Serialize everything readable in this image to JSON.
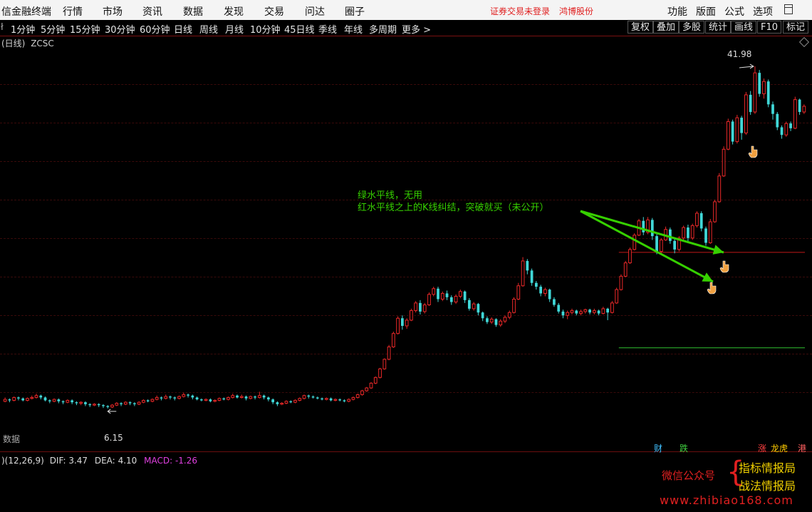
{
  "menu": {
    "app_title": "信金融终端",
    "items": [
      "行情",
      "市场",
      "资讯",
      "数据",
      "发现",
      "交易",
      "问达",
      "圈子"
    ],
    "warning": "证券交易未登录",
    "broker": "鸿博股份",
    "right_items": [
      "功能",
      "版面",
      "公式",
      "选项"
    ]
  },
  "periods": {
    "items": [
      "1分钟",
      "5分钟",
      "15分钟",
      "30分钟",
      "60分钟",
      "日线",
      "周线",
      "月线",
      "10分钟",
      "45日线",
      "季线",
      "年线",
      "多周期",
      "更多 >"
    ],
    "selected": "日线",
    "tools": [
      "复权",
      "叠加",
      "多股",
      "统计",
      "画线",
      "F10",
      "标记"
    ]
  },
  "chart_header": {
    "period_label": "(日线)",
    "code": "ZCSC"
  },
  "annotation": {
    "line1": "绿水平线，无用",
    "line2": "红水平线之上的K线纠结，突破就买（未公开）",
    "color": "#36d000"
  },
  "labels": {
    "high": "41.98",
    "low": "6.15",
    "data_tab": "数据"
  },
  "badges": {
    "cai": "财",
    "die": "跌",
    "zhang": "涨",
    "longhu": "龙虎",
    "gang": "港"
  },
  "macd": {
    "params": ")(12,26,9)",
    "dif_label": "DIF:",
    "dif": "3.47",
    "dea_label": "DEA:",
    "dea": "4.10",
    "macd_label": "MACD:",
    "macd": "-1.26"
  },
  "watermark": {
    "wechat": "微信公众号",
    "name1": "指标情报局",
    "name2": "战法情报局",
    "url": "www.zhibiao168.com"
  },
  "colors": {
    "up": "#e82828",
    "down": "#40d8d8",
    "grid": "#3a0a0a",
    "red_level": "#c01818",
    "green_level": "#30c030"
  },
  "chart_data": {
    "type": "candlestick",
    "ylim": [
      3,
      44
    ],
    "high_marker": 41.98,
    "low_marker": 6.15,
    "red_level": 22.5,
    "green_level": 12.5,
    "bars": [
      [
        6.9,
        7.1,
        7.3,
        6.8
      ],
      [
        7.1,
        7.0,
        7.2,
        6.8
      ],
      [
        7.0,
        7.3,
        7.4,
        6.9
      ],
      [
        7.3,
        7.2,
        7.4,
        7.0
      ],
      [
        7.2,
        7.0,
        7.3,
        6.9
      ],
      [
        7.0,
        7.2,
        7.3,
        6.9
      ],
      [
        7.2,
        7.3,
        7.5,
        7.1
      ],
      [
        7.3,
        7.5,
        7.7,
        7.2
      ],
      [
        7.5,
        7.3,
        7.6,
        7.1
      ],
      [
        7.3,
        7.0,
        7.4,
        6.9
      ],
      [
        7.0,
        6.9,
        7.1,
        6.7
      ],
      [
        6.9,
        7.1,
        7.2,
        6.8
      ],
      [
        7.1,
        6.9,
        7.2,
        6.7
      ],
      [
        6.9,
        6.8,
        7.0,
        6.6
      ],
      [
        6.8,
        7.0,
        7.1,
        6.7
      ],
      [
        7.0,
        6.8,
        7.1,
        6.6
      ],
      [
        6.8,
        6.7,
        6.9,
        6.5
      ],
      [
        6.7,
        6.8,
        6.9,
        6.5
      ],
      [
        6.8,
        6.6,
        6.9,
        6.4
      ],
      [
        6.6,
        6.5,
        6.7,
        6.3
      ],
      [
        6.5,
        6.6,
        6.7,
        6.4
      ],
      [
        6.6,
        6.5,
        6.7,
        6.3
      ],
      [
        6.5,
        6.4,
        6.6,
        6.2
      ],
      [
        6.4,
        6.3,
        6.5,
        6.15
      ],
      [
        6.3,
        6.5,
        6.6,
        6.2
      ],
      [
        6.5,
        6.7,
        6.8,
        6.4
      ],
      [
        6.7,
        6.6,
        6.8,
        6.4
      ],
      [
        6.6,
        6.8,
        6.9,
        6.5
      ],
      [
        6.8,
        6.7,
        6.9,
        6.5
      ],
      [
        6.7,
        6.6,
        6.8,
        6.4
      ],
      [
        6.6,
        6.8,
        6.9,
        6.5
      ],
      [
        6.8,
        7.0,
        7.1,
        6.7
      ],
      [
        7.0,
        6.9,
        7.1,
        6.8
      ],
      [
        6.9,
        7.1,
        7.2,
        6.8
      ],
      [
        7.1,
        7.3,
        7.5,
        7.0
      ],
      [
        7.3,
        7.2,
        7.4,
        7.0
      ],
      [
        7.2,
        7.4,
        7.6,
        7.1
      ],
      [
        7.4,
        7.3,
        7.5,
        7.1
      ],
      [
        7.3,
        7.2,
        7.4,
        7.0
      ],
      [
        7.2,
        7.4,
        7.5,
        7.1
      ],
      [
        7.4,
        7.6,
        7.8,
        7.3
      ],
      [
        7.6,
        7.5,
        7.7,
        7.3
      ],
      [
        7.5,
        7.3,
        7.6,
        7.1
      ],
      [
        7.3,
        7.1,
        7.4,
        7.0
      ],
      [
        7.1,
        7.0,
        7.2,
        6.9
      ],
      [
        7.0,
        7.1,
        7.2,
        6.9
      ],
      [
        7.1,
        6.9,
        7.2,
        6.8
      ],
      [
        6.9,
        7.0,
        7.1,
        6.8
      ],
      [
        7.0,
        7.2,
        7.3,
        6.9
      ],
      [
        7.2,
        7.1,
        7.3,
        7.0
      ],
      [
        7.1,
        7.3,
        7.4,
        7.0
      ],
      [
        7.3,
        7.5,
        7.7,
        7.2
      ],
      [
        7.5,
        7.3,
        7.6,
        7.2
      ],
      [
        7.3,
        7.4,
        7.6,
        7.2
      ],
      [
        7.4,
        7.2,
        7.5,
        7.0
      ],
      [
        7.2,
        7.4,
        7.5,
        7.1
      ],
      [
        7.4,
        7.3,
        7.5,
        7.1
      ],
      [
        7.3,
        7.5,
        7.9,
        7.2
      ],
      [
        7.5,
        7.3,
        7.6,
        7.1
      ],
      [
        7.3,
        7.1,
        7.4,
        6.9
      ],
      [
        7.1,
        6.8,
        7.2,
        6.6
      ],
      [
        6.8,
        6.6,
        6.9,
        6.4
      ],
      [
        6.6,
        6.7,
        6.8,
        6.5
      ],
      [
        6.7,
        6.9,
        7.0,
        6.6
      ],
      [
        6.9,
        6.8,
        7.0,
        6.7
      ],
      [
        6.8,
        7.0,
        7.1,
        6.7
      ],
      [
        7.0,
        7.2,
        7.3,
        6.9
      ],
      [
        7.2,
        7.5,
        7.6,
        7.1
      ],
      [
        7.5,
        7.4,
        7.6,
        7.2
      ],
      [
        7.4,
        7.3,
        7.5,
        7.2
      ],
      [
        7.3,
        7.2,
        7.4,
        7.1
      ],
      [
        7.2,
        7.1,
        7.3,
        7.0
      ],
      [
        7.1,
        7.2,
        7.3,
        7.0
      ],
      [
        7.2,
        7.0,
        7.3,
        6.9
      ],
      [
        7.0,
        7.1,
        7.2,
        6.9
      ],
      [
        7.1,
        7.0,
        7.2,
        6.9
      ],
      [
        7.0,
        6.9,
        7.1,
        6.8
      ],
      [
        6.9,
        7.1,
        7.2,
        6.8
      ],
      [
        7.1,
        7.3,
        7.4,
        7.0
      ],
      [
        7.3,
        7.6,
        7.7,
        7.2
      ],
      [
        7.6,
        8.0,
        8.1,
        7.5
      ],
      [
        8.0,
        8.3,
        8.4,
        7.9
      ],
      [
        8.3,
        8.8,
        8.9,
        8.2
      ],
      [
        8.8,
        9.4,
        9.5,
        8.7
      ],
      [
        9.4,
        10.3,
        10.4,
        9.3
      ],
      [
        10.3,
        11.3,
        11.4,
        10.2
      ],
      [
        11.3,
        12.6,
        12.8,
        11.2
      ],
      [
        12.6,
        14.0,
        14.2,
        12.5
      ],
      [
        14.0,
        15.6,
        15.8,
        13.9
      ],
      [
        15.6,
        14.8,
        15.9,
        14.4
      ],
      [
        14.8,
        15.4,
        15.6,
        14.5
      ],
      [
        15.4,
        16.4,
        16.6,
        15.3
      ],
      [
        16.4,
        17.2,
        17.4,
        16.2
      ],
      [
        17.2,
        16.3,
        17.5,
        16.0
      ],
      [
        16.3,
        17.0,
        17.2,
        16.1
      ],
      [
        17.0,
        18.1,
        18.3,
        16.9
      ],
      [
        18.1,
        18.7,
        18.9,
        17.9
      ],
      [
        18.7,
        17.6,
        18.9,
        17.3
      ],
      [
        17.6,
        18.2,
        18.4,
        17.4
      ],
      [
        18.2,
        17.8,
        18.5,
        17.5
      ],
      [
        17.8,
        17.3,
        18.0,
        17.0
      ],
      [
        17.3,
        17.9,
        18.1,
        17.1
      ],
      [
        17.9,
        18.4,
        18.6,
        17.7
      ],
      [
        18.4,
        17.5,
        18.5,
        17.2
      ],
      [
        17.5,
        16.6,
        17.7,
        16.4
      ],
      [
        16.6,
        17.1,
        17.3,
        16.4
      ],
      [
        17.1,
        16.2,
        17.2,
        15.9
      ],
      [
        16.2,
        15.6,
        16.3,
        15.3
      ],
      [
        15.6,
        15.2,
        15.8,
        15.0
      ],
      [
        15.2,
        15.5,
        15.7,
        15.0
      ],
      [
        15.5,
        14.9,
        15.6,
        14.7
      ],
      [
        14.9,
        15.3,
        15.5,
        14.7
      ],
      [
        15.3,
        15.7,
        15.9,
        15.1
      ],
      [
        15.7,
        16.2,
        16.4,
        15.5
      ],
      [
        16.2,
        17.6,
        17.8,
        16.1
      ],
      [
        17.6,
        19.0,
        19.3,
        17.5
      ],
      [
        19.0,
        21.6,
        22.0,
        18.9
      ],
      [
        21.6,
        20.6,
        21.8,
        20.2
      ],
      [
        20.6,
        19.3,
        20.8,
        19.0
      ],
      [
        19.3,
        18.9,
        19.5,
        18.6
      ],
      [
        18.9,
        18.2,
        19.1,
        17.9
      ],
      [
        18.2,
        18.6,
        18.8,
        17.9
      ],
      [
        18.6,
        17.6,
        18.7,
        17.3
      ],
      [
        17.6,
        17.0,
        17.8,
        16.8
      ],
      [
        17.0,
        16.3,
        17.2,
        16.1
      ],
      [
        16.3,
        15.9,
        16.5,
        15.6
      ],
      [
        15.9,
        16.2,
        16.4,
        15.5
      ],
      [
        16.2,
        16.4,
        16.6,
        16.0
      ],
      [
        16.4,
        16.1,
        16.5,
        15.9
      ],
      [
        16.1,
        16.3,
        16.5,
        15.9
      ],
      [
        16.3,
        16.5,
        16.6,
        16.1
      ],
      [
        16.5,
        16.2,
        16.6,
        16.0
      ],
      [
        16.2,
        16.4,
        16.6,
        16.0
      ],
      [
        16.4,
        16.1,
        16.5,
        15.9
      ],
      [
        16.1,
        16.6,
        16.8,
        16.0
      ],
      [
        16.6,
        16.2,
        16.7,
        15.4
      ],
      [
        16.2,
        17.2,
        17.4,
        16.1
      ],
      [
        17.2,
        18.6,
        18.8,
        17.1
      ],
      [
        18.6,
        20.0,
        20.2,
        18.5
      ],
      [
        20.0,
        21.4,
        21.6,
        19.9
      ],
      [
        21.4,
        22.8,
        23.0,
        21.3
      ],
      [
        22.8,
        24.3,
        24.5,
        22.7
      ],
      [
        24.3,
        25.8,
        26.0,
        24.2
      ],
      [
        25.8,
        24.6,
        26.2,
        24.3
      ],
      [
        24.6,
        25.9,
        26.2,
        24.4
      ],
      [
        25.9,
        24.2,
        26.1,
        23.8
      ],
      [
        24.2,
        22.6,
        24.4,
        22.3
      ],
      [
        22.6,
        23.8,
        24.0,
        22.4
      ],
      [
        23.8,
        24.9,
        25.2,
        23.7
      ],
      [
        24.9,
        23.7,
        25.1,
        23.4
      ],
      [
        23.7,
        22.8,
        23.9,
        22.4
      ],
      [
        22.8,
        24.0,
        24.2,
        22.6
      ],
      [
        24.0,
        25.1,
        25.3,
        23.8
      ],
      [
        25.1,
        24.0,
        25.4,
        23.6
      ],
      [
        24.0,
        25.3,
        25.5,
        23.8
      ],
      [
        25.3,
        26.6,
        26.8,
        25.1
      ],
      [
        26.6,
        25.0,
        26.8,
        24.7
      ],
      [
        25.0,
        23.5,
        25.2,
        23.2
      ],
      [
        23.5,
        25.7,
        26.0,
        23.4
      ],
      [
        25.7,
        27.8,
        28.0,
        25.6
      ],
      [
        27.8,
        30.5,
        30.8,
        27.7
      ],
      [
        30.5,
        33.3,
        33.6,
        30.4
      ],
      [
        33.3,
        36.2,
        36.5,
        33.2
      ],
      [
        36.2,
        34.1,
        36.4,
        33.8
      ],
      [
        34.1,
        36.6,
        36.9,
        33.9
      ],
      [
        36.6,
        35.0,
        36.8,
        34.3
      ],
      [
        35.0,
        39.0,
        39.3,
        34.8
      ],
      [
        39.0,
        37.2,
        39.4,
        36.9
      ],
      [
        37.2,
        41.3,
        41.98,
        37.0
      ],
      [
        41.3,
        39.1,
        41.6,
        38.8
      ],
      [
        39.1,
        40.4,
        40.7,
        38.6
      ],
      [
        40.4,
        38.0,
        40.6,
        37.7
      ],
      [
        38.0,
        37.0,
        38.3,
        36.4
      ],
      [
        37.0,
        35.6,
        37.2,
        35.3
      ],
      [
        35.6,
        34.8,
        35.8,
        34.4
      ],
      [
        34.8,
        36.0,
        36.2,
        34.6
      ],
      [
        36.0,
        35.5,
        36.2,
        35.2
      ],
      [
        35.5,
        38.5,
        38.8,
        35.4
      ],
      [
        38.5,
        37.2,
        38.6,
        36.9
      ],
      [
        37.2,
        37.8,
        38.0,
        37.0
      ]
    ]
  }
}
